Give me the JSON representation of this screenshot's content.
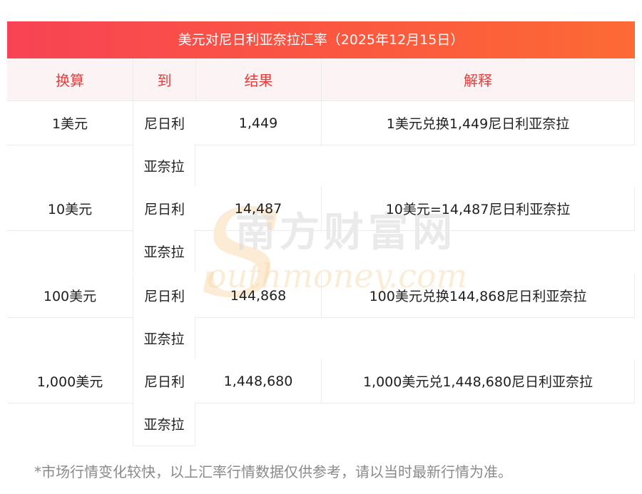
{
  "title": "美元对尼日利亚奈拉汇率（2025年12月15日）",
  "headers": [
    "换算",
    "到",
    "结果",
    "解释"
  ],
  "rows": [
    {
      "amount": "1美元",
      "to_line1": "尼日利",
      "to_line2": "亚奈拉",
      "result": "1,449",
      "explain": "1美元兑换1,449尼日利亚奈拉"
    },
    {
      "amount": "10美元",
      "to_line1": "尼日利",
      "to_line2": "亚奈拉",
      "result": "14,487",
      "explain": "10美元=14,487尼日利亚奈拉"
    },
    {
      "amount": "100美元",
      "to_line1": "尼日利",
      "to_line2": "亚奈拉",
      "result": "144,868",
      "explain": "100美元兑换144,868尼日利亚奈拉"
    },
    {
      "amount": "1,000美元",
      "to_line1": "尼日利",
      "to_line2": "亚奈拉",
      "result": "1,448,680",
      "explain": "1,000美元兑1,448,680尼日利亚奈拉"
    }
  ],
  "footnote": "*市场行情变化较快，以上汇率行情数据仅供参考，请以当时最新行情为准。",
  "watermark": {
    "cn": "南方财富网",
    "en": "outhmoney.com"
  },
  "colors": {
    "title_bg_start": "#f84354",
    "title_bg_end": "#fd6a35",
    "header_text": "#e63c3c",
    "header_bg": "#fcf4f4"
  }
}
